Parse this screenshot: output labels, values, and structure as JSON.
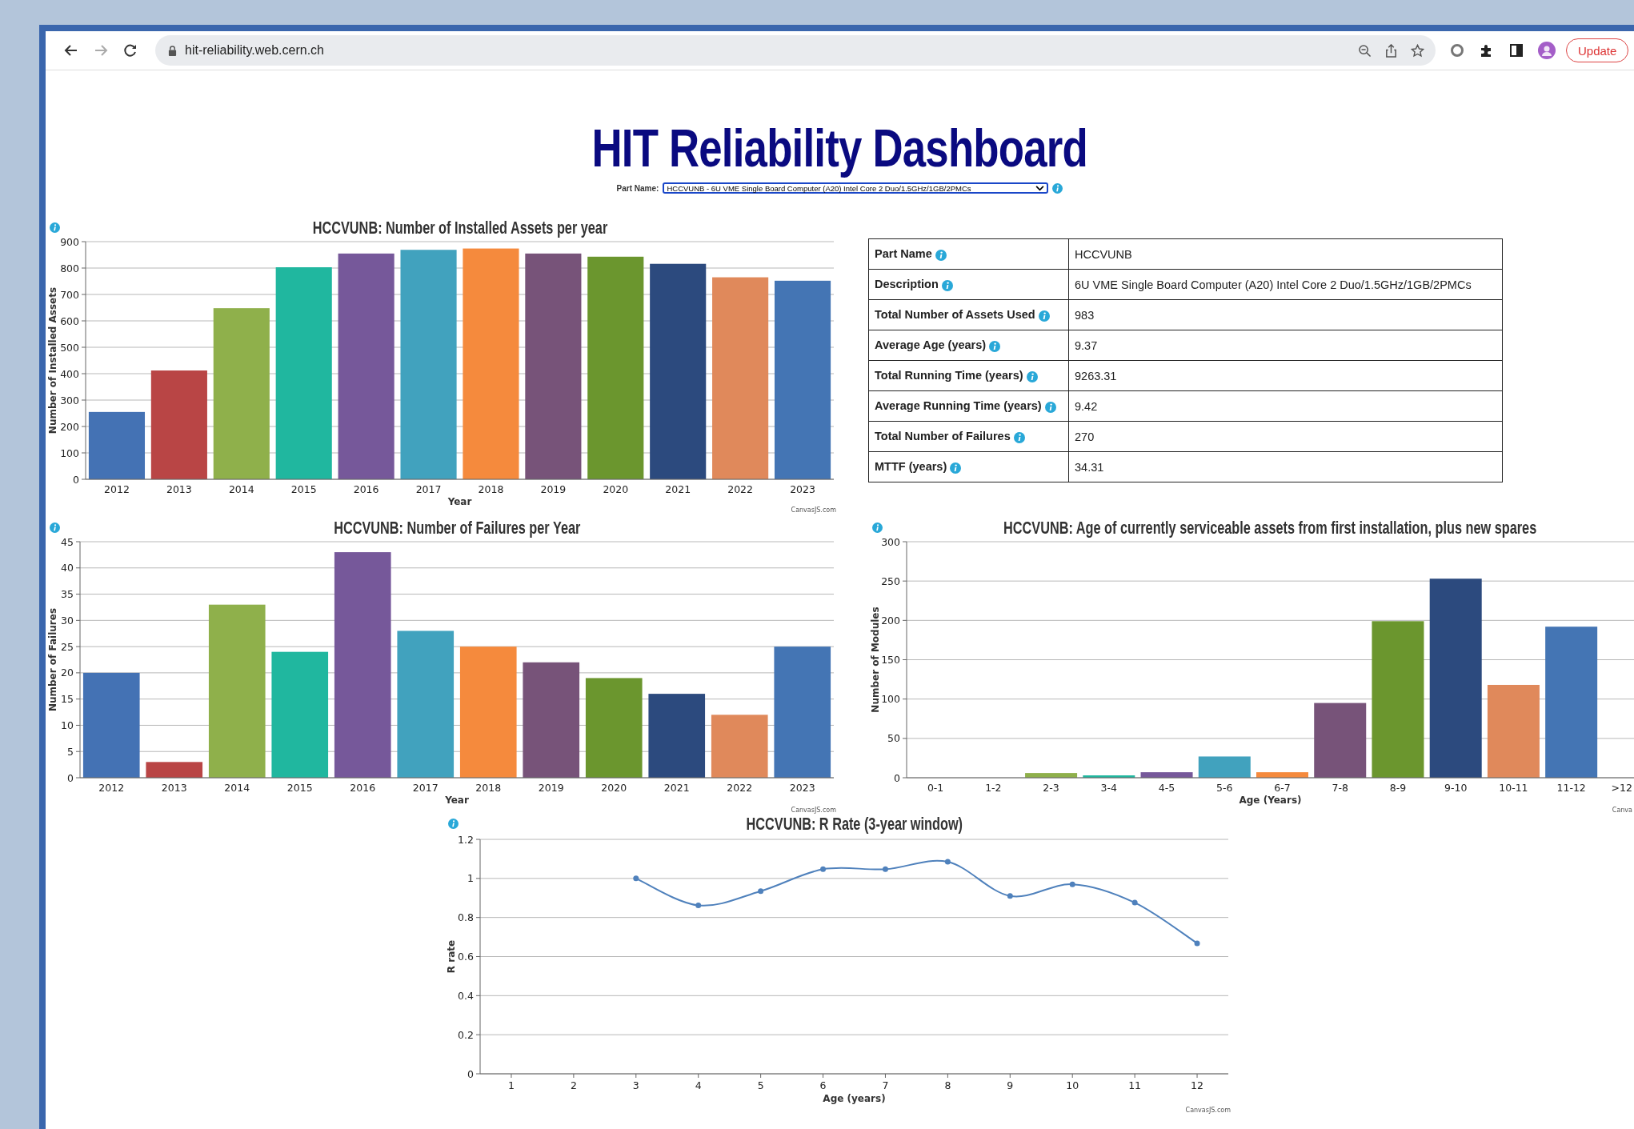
{
  "browser": {
    "url": "hit-reliability.web.cern.ch",
    "update_button": "Update"
  },
  "page_title": "HIT Reliability Dashboard",
  "part_selector": {
    "label": "Part Name:",
    "value": "HCCVUNB - 6U VME Single Board Computer (A20) Intel Core 2 Duo/1.5GHz/1GB/2PMCs"
  },
  "bar_charts": [
    {
      "credit": "CanvasJS.com",
      "chart_data": {
        "type": "bar",
        "title": "HCCVUNB: Number of Installed Assets per year",
        "xlabel": "Year",
        "ylabel": "Number of Installed Assets",
        "categories": [
          "2012",
          "2013",
          "2014",
          "2015",
          "2016",
          "2017",
          "2018",
          "2019",
          "2020",
          "2021",
          "2022",
          "2023"
        ],
        "values": [
          255,
          412,
          648,
          803,
          855,
          869,
          874,
          855,
          843,
          816,
          765,
          752
        ],
        "ylim": [
          0,
          900
        ],
        "yticks": [
          0,
          100,
          200,
          300,
          400,
          500,
          600,
          700,
          800,
          900
        ],
        "grid": true
      }
    },
    {
      "credit": "CanvasJS.com",
      "chart_data": {
        "type": "bar",
        "title": "HCCVUNB: Number of Failures per Year",
        "xlabel": "Year",
        "ylabel": "Number of Failures",
        "categories": [
          "2012",
          "2013",
          "2014",
          "2015",
          "2016",
          "2017",
          "2018",
          "2019",
          "2020",
          "2021",
          "2022",
          "2023"
        ],
        "values": [
          20,
          3,
          33,
          24,
          43,
          28,
          25,
          22,
          19,
          16,
          12,
          25
        ],
        "ylim": [
          0,
          45
        ],
        "yticks": [
          0,
          5,
          10,
          15,
          20,
          25,
          30,
          35,
          40,
          45
        ],
        "grid": true
      }
    },
    {
      "credit": "Canva",
      "chart_data": {
        "type": "bar",
        "title": "HCCVUNB: Age of currently serviceable assets from first installation, plus new spares",
        "xlabel": "Age (Years)",
        "ylabel": "Number of Modules",
        "categories": [
          "0-1",
          "1-2",
          "2-3",
          "3-4",
          "4-5",
          "5-6",
          "6-7",
          "7-8",
          "8-9",
          "9-10",
          "10-11",
          "11-12",
          ">12"
        ],
        "values": [
          0,
          0,
          6,
          3,
          7,
          27,
          7,
          95,
          199,
          253,
          118,
          192,
          0
        ],
        "ylim": [
          0,
          300
        ],
        "yticks": [
          0,
          50,
          100,
          150,
          200,
          250,
          300
        ],
        "grid": true
      }
    }
  ],
  "summary_table": [
    {
      "label": "Part Name",
      "value": "HCCVUNB"
    },
    {
      "label": "Description",
      "value": "6U VME Single Board Computer (A20) Intel Core 2 Duo/1.5GHz/1GB/2PMCs"
    },
    {
      "label": "Total Number of Assets Used",
      "value": "983"
    },
    {
      "label": "Average Age (years)",
      "value": "9.37"
    },
    {
      "label": "Total Running Time (years)",
      "value": "9263.31"
    },
    {
      "label": "Average Running Time (years)",
      "value": "9.42"
    },
    {
      "label": "Total Number of Failures",
      "value": "270"
    },
    {
      "label": "MTTF (years)",
      "value": "34.31"
    }
  ],
  "r_rate_chart": {
    "credit": "CanvasJS.com",
    "chart_data": {
      "type": "line",
      "title": "HCCVUNB: R Rate (3-year window)",
      "xlabel": "Age (years)",
      "ylabel": "R rate",
      "x": [
        3,
        4,
        5,
        6,
        7,
        8,
        9,
        10,
        11,
        12
      ],
      "series": [
        {
          "color": "#4f81bc",
          "marker": "circle",
          "values": [
            1,
            0.862,
            0.935,
            1.047,
            1.047,
            1.085,
            0.91,
            0.97,
            0.876,
            0.668
          ]
        }
      ],
      "xlim": [
        0.5,
        12.5
      ],
      "ylim": [
        0,
        1.2
      ],
      "xticks": [
        1,
        2,
        3,
        4,
        5,
        6,
        7,
        8,
        9,
        10,
        11,
        12
      ],
      "yticks": [
        0,
        {
          "value": 0.2,
          "label": "0.2"
        },
        {
          "value": 0.4,
          "label": "0.4"
        },
        {
          "value": 0.6,
          "label": "0.6"
        },
        {
          "value": 0.8,
          "label": "0.8"
        },
        1,
        {
          "value": 1.2,
          "label": "1.2"
        }
      ],
      "grid": true
    }
  }
}
